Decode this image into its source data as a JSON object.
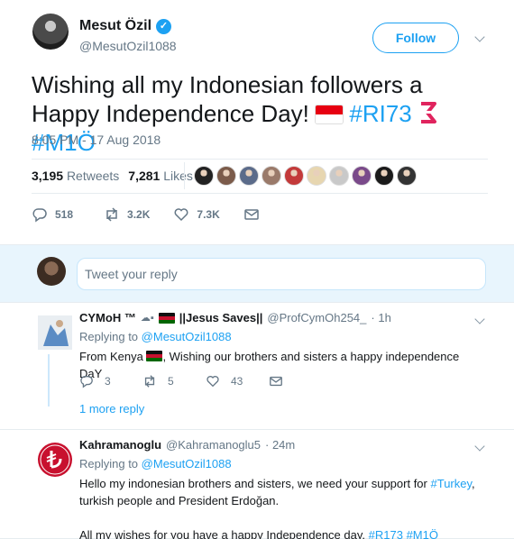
{
  "main_tweet": {
    "author_name": "Mesut Özil",
    "verified_icon": "verified-badge-icon",
    "handle": "@MesutOzil1088",
    "follow_label": "Follow",
    "text_part1": "Wishing all my Indonesian followers a Happy Independence Day!",
    "hashtag1": "#RI73",
    "hashtag2": "#M1Ö",
    "timestamp": "8:05 PM - 17 Aug 2018",
    "retweets_count": "3,195",
    "retweets_label": "Retweets",
    "likes_count": "7,281",
    "likes_label": "Likes",
    "liker_colors": [
      "#222222",
      "#7b5b4a",
      "#5b6b8a",
      "#9a7a6a",
      "#c33a3a",
      "#e7d6b0",
      "#c9c9c9",
      "#7a4a8a",
      "#1a1a1a",
      "#333333"
    ],
    "actions": {
      "reply_count": "518",
      "retweet_count": "3.2K",
      "like_count": "7.3K"
    }
  },
  "composer": {
    "placeholder": "Tweet your reply"
  },
  "replies": [
    {
      "name": "CYMoH ™",
      "name_suffix": "||Jesus Saves||",
      "handle": "@ProfCymOh254_",
      "time": "· 1h",
      "replying_prefix": "Replying to",
      "replying_to": "@MesutOzil1088",
      "text_prefix": "From Kenya",
      "text_rest": ", Wishing  our brothers and sisters  a happy  independence  DaY",
      "reply_count": "3",
      "retweet_count": "5",
      "like_count": "43",
      "more_replies": "1 more reply"
    },
    {
      "name": "Kahramanoglu",
      "handle": "@Kahramanoglu5",
      "time": "· 24m",
      "replying_prefix": "Replying to",
      "replying_to": "@MesutOzil1088",
      "text_line1_prefix": "Hello my indonesian brothers and sisters, we need your support for",
      "text_line1_tag": "#Turkey",
      "text_line1_suffix": ",",
      "text_line2": "turkish people and President Erdoğan.",
      "text_line3_prefix": "All my wishes for you have a happy Independence day.",
      "text_line3_tag1": "#R173",
      "text_line3_tag2": "#M1Ö"
    }
  ]
}
